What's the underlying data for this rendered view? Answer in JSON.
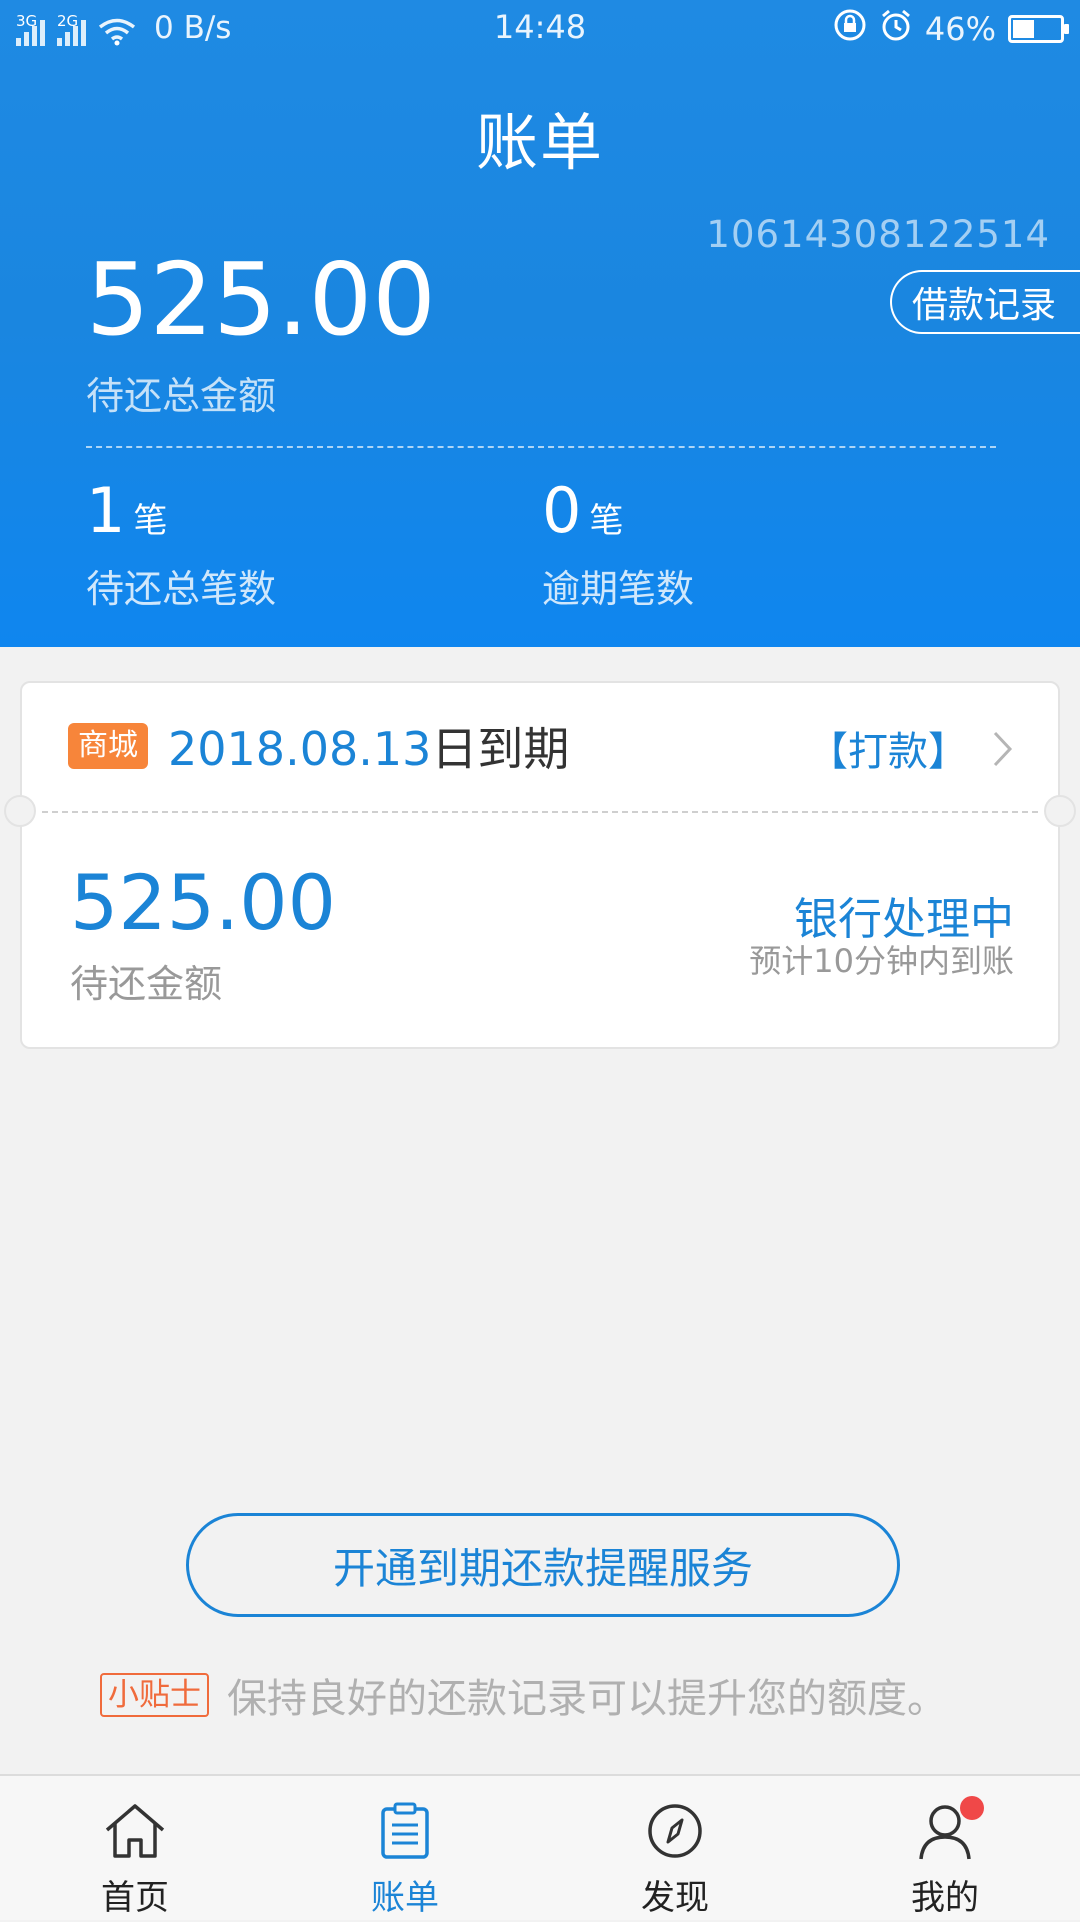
{
  "status_bar": {
    "net1": "3G",
    "net2": "2G",
    "speed": "0 B/s",
    "time": "14:48",
    "battery": "46%",
    "battery_level": 0.46
  },
  "header": {
    "title": "账单",
    "account_id": "10614308122514",
    "loan_record_label": "借款记录",
    "total_amount": "525.00",
    "total_amount_label": "待还总金额",
    "stats": [
      {
        "num": "1",
        "unit": "笔",
        "label": "待还总笔数"
      },
      {
        "num": "0",
        "unit": "笔",
        "label": "逾期笔数"
      }
    ]
  },
  "bill": {
    "tag": "商城",
    "due_date": "2018.08.13",
    "due_suffix": "日到期",
    "pay_label": "【打款】",
    "amount": "525.00",
    "amount_label": "待还金额",
    "status": "银行处理中",
    "eta": "预计10分钟内到账"
  },
  "reminder_button": "开通到期还款提醒服务",
  "tip": {
    "badge": "小贴士",
    "text": "保持良好的还款记录可以提升您的额度。"
  },
  "nav": [
    {
      "label": "首页",
      "icon": "home-icon"
    },
    {
      "label": "账单",
      "icon": "bill-icon"
    },
    {
      "label": "发现",
      "icon": "compass-icon"
    },
    {
      "label": "我的",
      "icon": "user-icon"
    }
  ],
  "colors": {
    "primary": "#1b84d6",
    "header_blue": "#1a86e0",
    "mall_tag": "#f7853a",
    "tip_badge": "#f06b3c",
    "notify_dot": "#f04848"
  }
}
